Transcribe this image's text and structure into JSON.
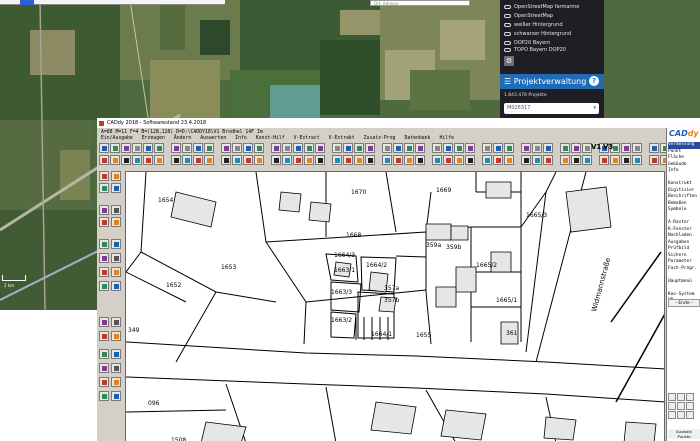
{
  "background_app": {
    "search_placeholder": "Ort, Adresse",
    "layers": [
      {
        "label": "OpenStreetMap farmarme"
      },
      {
        "label": "OpenStreetMap"
      },
      {
        "label": "weißer Hintergrund"
      },
      {
        "label": "schwarzer Hintergrund"
      },
      {
        "label": "DOP20 Bayern"
      },
      {
        "label": "TOPO Bayern DOP20"
      }
    ],
    "project_panel": {
      "title": "Projektverwaltung",
      "help": "?",
      "count": "1.843.478 Projekte",
      "selected": "M026317"
    },
    "scale_label": "2 km",
    "colors": {
      "panel_bg": "#1d1f24",
      "project_blue": "#1f6bb5",
      "accent_blue": "#2c5fd6"
    }
  },
  "cad": {
    "title": "CADdy 2018 - Softwarestand 23.4.2018",
    "path": "A=88  M=11  F=4  B=(128,128)  D=D:\\CADDY18\\V1  Brodhel 14F Im",
    "menu": [
      "Ein/Ausgabe",
      "Erzeugen",
      "Ändern",
      "Auswerten",
      "Info",
      "Konst-Hilf",
      "V-Extract",
      "V-Extrakt",
      "Zusatz-Prog",
      "Datenbank",
      "Hilfe"
    ],
    "toolbar_text": [
      "V1",
      "V3"
    ],
    "logo_main": "CAD",
    "logo_accent": "dy",
    "right_menu": [
      {
        "label": "Vermessung",
        "selected": true
      },
      {
        "label": "Punkt",
        "selected": false
      },
      {
        "label": "Fläche",
        "selected": false
      },
      {
        "label": "Gebäude",
        "selected": false
      },
      {
        "label": "Info",
        "selected": false
      },
      {
        "label": "",
        "selected": false
      },
      {
        "label": "Konstrukt",
        "selected": false
      },
      {
        "label": "Digitisier",
        "selected": false
      },
      {
        "label": "Beschriften",
        "selected": false
      },
      {
        "label": "Bemaßen",
        "selected": false
      },
      {
        "label": "Symbole",
        "selected": false
      },
      {
        "label": "",
        "selected": false
      },
      {
        "label": "A-Raster",
        "selected": false
      },
      {
        "label": "K-Fenster",
        "selected": false
      },
      {
        "label": "Nachladen",
        "selected": false
      },
      {
        "label": "Ausgaben",
        "selected": false
      },
      {
        "label": "Prüfbild",
        "selected": false
      },
      {
        "label": "Sichern",
        "selected": false
      },
      {
        "label": "Parameter",
        "selected": false
      },
      {
        "label": "Fach-Progr.",
        "selected": false
      },
      {
        "label": "",
        "selected": false
      },
      {
        "label": "Hauptmenü",
        "selected": false
      },
      {
        "label": "",
        "selected": false
      },
      {
        "label": "Koo-System",
        "selected": false
      },
      {
        "label": "UR",
        "selected": false
      }
    ],
    "right_ende": "- Ende -",
    "right_bottom": [
      "Auswahl",
      "Punkte"
    ],
    "parcels": [
      {
        "label": "1670"
      },
      {
        "label": "1669"
      },
      {
        "label": "1654"
      },
      {
        "label": "1653"
      },
      {
        "label": "1652"
      },
      {
        "label": "1668"
      },
      {
        "label": "1665/3"
      },
      {
        "label": "1665/2"
      },
      {
        "label": "1665/1"
      },
      {
        "label": "359a"
      },
      {
        "label": "359b"
      },
      {
        "label": "1664/2"
      },
      {
        "label": "1663/1"
      },
      {
        "label": "1664/1"
      },
      {
        "label": "1655"
      },
      {
        "label": "361"
      },
      {
        "label": "349"
      },
      {
        "label": "1664/3"
      },
      {
        "label": "1663/3"
      },
      {
        "label": "1663/2"
      },
      {
        "label": "357a"
      },
      {
        "label": "357b"
      },
      {
        "label": "1508"
      },
      {
        "label": "096"
      }
    ],
    "street_name": "Widmannstraße",
    "colors": {
      "window": "#d4d0c8",
      "menu_select": "#2b4a9e",
      "logo_blue": "#1c5fb4",
      "logo_orange": "#e2831a"
    }
  }
}
